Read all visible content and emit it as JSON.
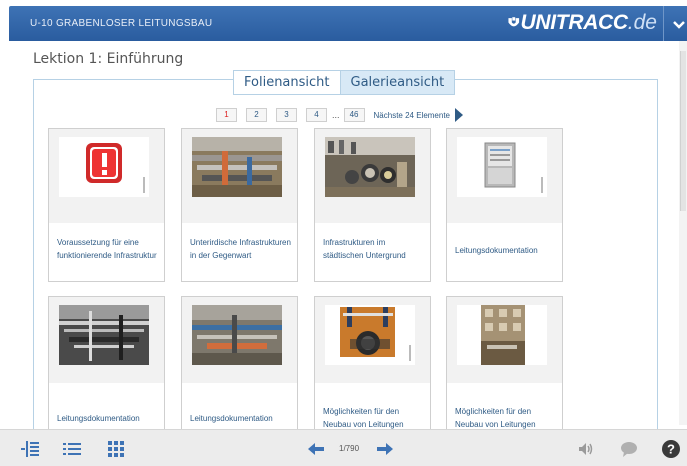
{
  "header": {
    "course_title": "U-10 GRABENLOSER LEITUNGSBAU",
    "logo_text": "UNITRACC",
    "logo_tld": ".de",
    "colors": {
      "bar": "#2f66ac",
      "text": "#ffffff"
    }
  },
  "lesson": {
    "title": "Lektion 1: Einführung"
  },
  "tabs": [
    {
      "label": "Folienansicht",
      "active": false
    },
    {
      "label": "Galerieansicht",
      "active": true
    }
  ],
  "pagination": {
    "pages": [
      "1",
      "2",
      "3",
      "4"
    ],
    "current": "1",
    "ellipsis": "...",
    "last": "46",
    "next_label": "Nächste 24 Elemente"
  },
  "cards": [
    {
      "label": "Voraussetzung für eine funktionierende Infrastruktur",
      "icon": "warning-icon"
    },
    {
      "label": "Unterirdische Infrastrukturen in der Gegenwart",
      "icon": "pipes-photo"
    },
    {
      "label": "Infrastrukturen im städtischen Untergrund",
      "icon": "pipe-model-photo"
    },
    {
      "label": "Leitungsdokumentation",
      "icon": "cabinet-photo"
    },
    {
      "label": "Leitungsdokumentation",
      "icon": "bw-photo"
    },
    {
      "label": "Leitungsdokumentation",
      "icon": "excavation-photo"
    },
    {
      "label": "Möglichkeiten für den Neubau von Leitungen",
      "icon": "pipe-diagram"
    },
    {
      "label": "Möglichkeiten für den Neubau von Leitungen",
      "icon": "building-photo"
    }
  ],
  "toolbar": {
    "page_count": "1/790",
    "icons": [
      "outline-icon",
      "list-icon",
      "grid-icon",
      "back-arrow-icon",
      "forward-arrow-icon",
      "audio-icon",
      "comment-icon",
      "help-icon"
    ]
  }
}
